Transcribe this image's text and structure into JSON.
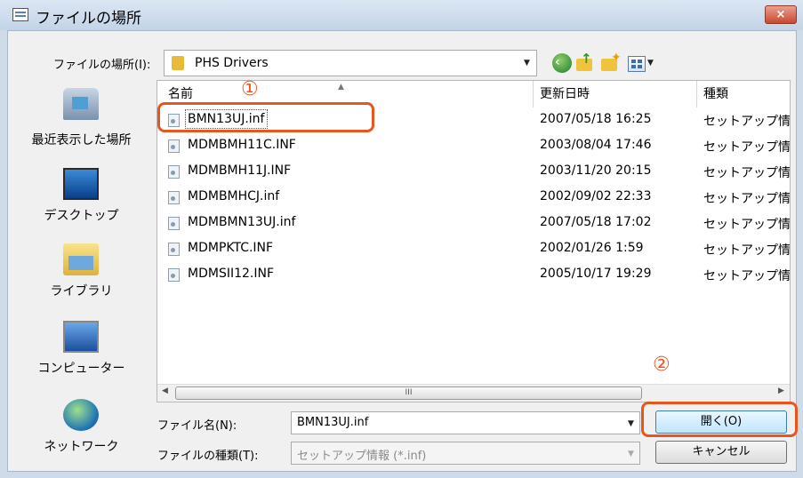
{
  "window": {
    "title": "ファイルの場所",
    "close_label": "×"
  },
  "toolbar": {
    "location_label": "ファイルの場所(I):",
    "location_value": "PHS Drivers",
    "back_icon": "back-arrow-icon",
    "up_icon": "up-folder-icon",
    "new_folder_icon": "new-folder-icon",
    "view_icon": "view-menu-icon"
  },
  "places": [
    {
      "label": "最近表示した場所",
      "icon": "recent-places-icon"
    },
    {
      "label": "デスクトップ",
      "icon": "desktop-icon"
    },
    {
      "label": "ライブラリ",
      "icon": "library-icon"
    },
    {
      "label": "コンピューター",
      "icon": "computer-icon"
    },
    {
      "label": "ネットワーク",
      "icon": "network-icon"
    }
  ],
  "columns": {
    "name": "名前",
    "date": "更新日時",
    "type": "種類"
  },
  "files": [
    {
      "name": "BMN13UJ.inf",
      "date": "2007/05/18 16:25",
      "type": "セットアップ情"
    },
    {
      "name": "MDMBMH11C.INF",
      "date": "2003/08/04 17:46",
      "type": "セットアップ情"
    },
    {
      "name": "MDMBMH11J.INF",
      "date": "2003/11/20 20:15",
      "type": "セットアップ情"
    },
    {
      "name": "MDMBMHCJ.inf",
      "date": "2002/09/02 22:33",
      "type": "セットアップ情"
    },
    {
      "name": "MDMBMN13UJ.inf",
      "date": "2007/05/18 17:02",
      "type": "セットアップ情"
    },
    {
      "name": "MDMPKTC.INF",
      "date": "2002/01/26 1:59",
      "type": "セットアップ情"
    },
    {
      "name": "MDMSII12.INF",
      "date": "2005/10/17 19:29",
      "type": "セットアップ情"
    }
  ],
  "filename": {
    "label": "ファイル名(N):",
    "value": "BMN13UJ.inf"
  },
  "filetype": {
    "label": "ファイルの種類(T):",
    "value": "セットアップ情報 (*.inf)"
  },
  "buttons": {
    "open": "開く(O)",
    "cancel": "キャンセル"
  },
  "annotations": {
    "one": "①",
    "two": "②",
    "color": "#e8561f"
  },
  "scrollbar": {
    "grip": "III"
  }
}
